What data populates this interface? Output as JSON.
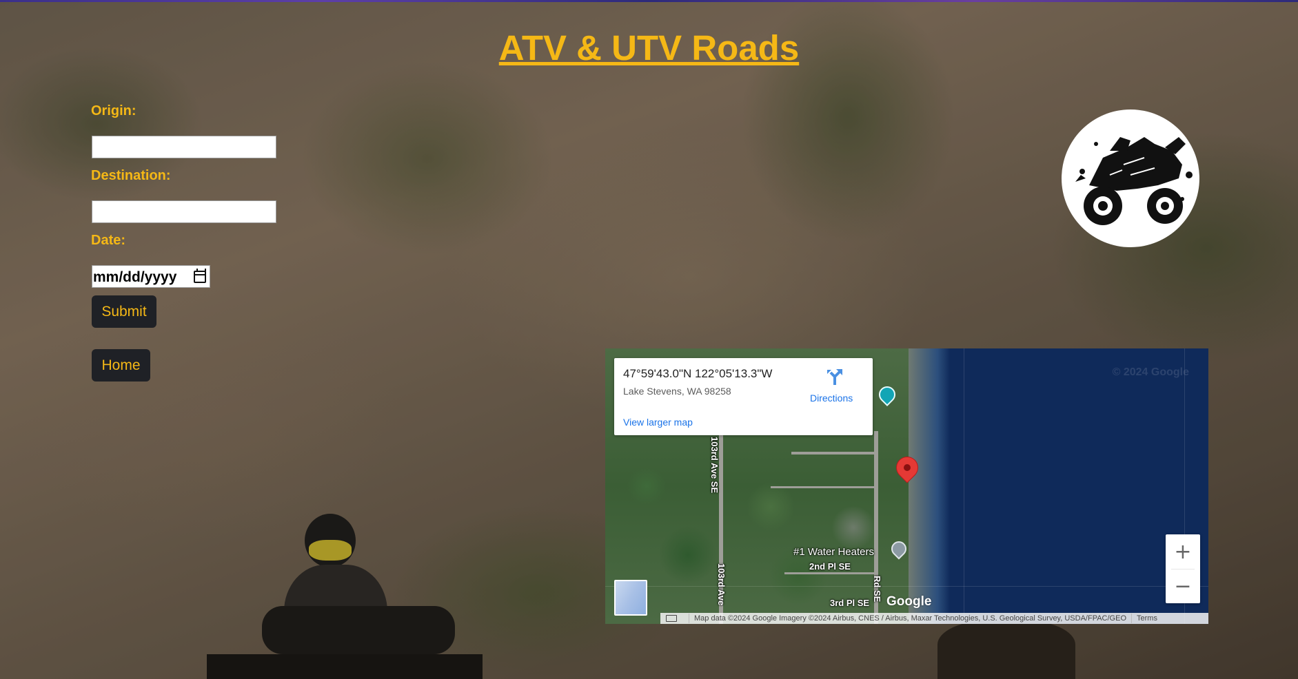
{
  "page": {
    "title": "ATV & UTV Roads"
  },
  "form": {
    "origin_label": "Origin:",
    "origin_value": "",
    "destination_label": "Destination:",
    "destination_value": "",
    "date_label": "Date:",
    "date_placeholder": "mm/dd/yyyy",
    "submit_label": "Submit",
    "home_label": "Home"
  },
  "colors": {
    "accent": "#f5b816",
    "button_bg": "#1f2126",
    "pin": "#e53935",
    "link": "#1a73e8"
  },
  "logo": {
    "icon": "atv-quad-bike-icon"
  },
  "map": {
    "info_card": {
      "coordinates": "47°59'43.0\"N 122°05'13.3\"W",
      "address": "Lake Stevens, WA 98258",
      "directions_label": "Directions",
      "larger_map_link": "View larger map"
    },
    "labels": {
      "road_103rd_top": "103rd Ave SE",
      "road_103rd_bottom": "103rd Ave",
      "road_right": "Rd SE",
      "poi": "#1 Water Heaters",
      "street_2nd": "2nd Pl SE",
      "street_3rd": "3rd Pl SE",
      "watermark": "© 2024 Google"
    },
    "zoom_in": "+",
    "zoom_out": "−",
    "google_logo": "Google",
    "attribution": "Map data ©2024 Google Imagery ©2024 Airbus, CNES / Airbus, Maxar Technologies, U.S. Geological Survey, USDA/FPAC/GEO",
    "terms": "Terms"
  }
}
